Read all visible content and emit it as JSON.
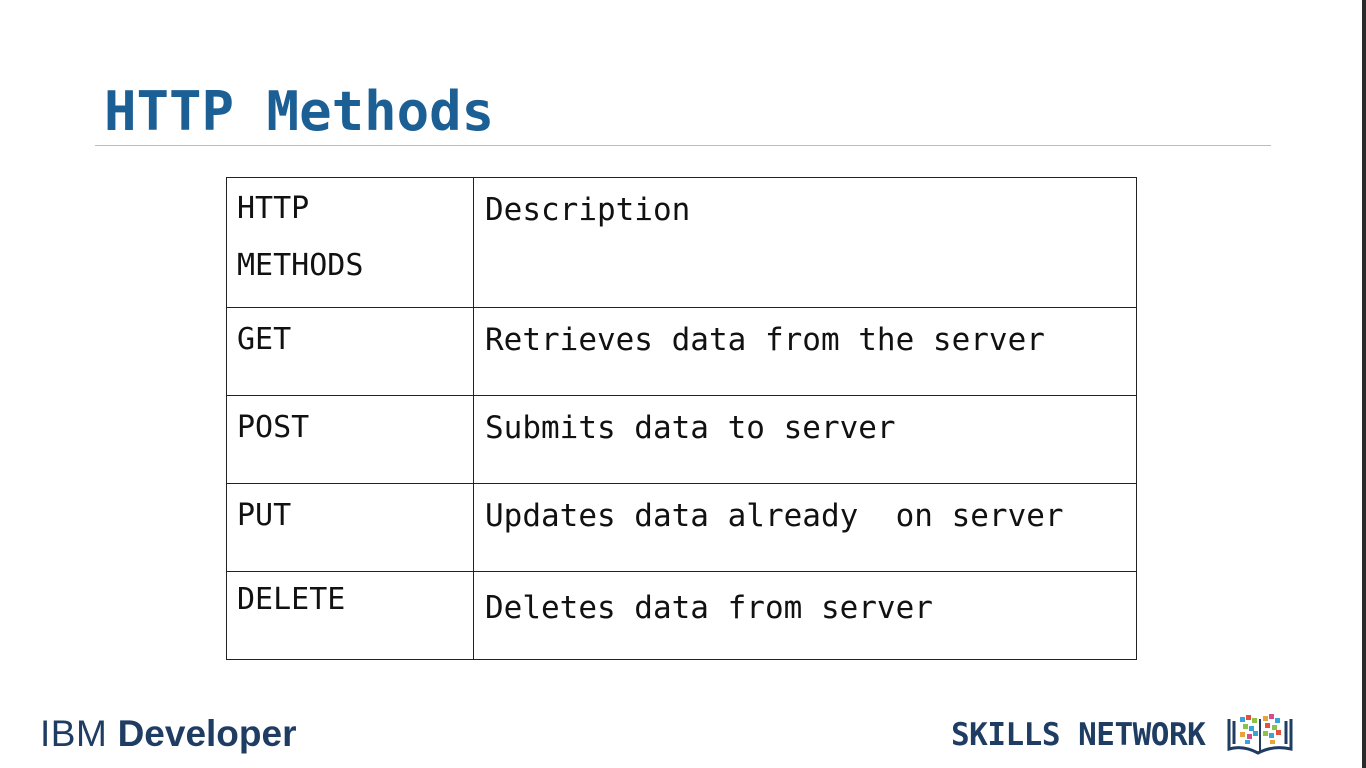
{
  "slide": {
    "title": "HTTP Methods"
  },
  "table": {
    "header": {
      "method_line1": "HTTP",
      "method_line2": "METHODS",
      "description": "Description"
    },
    "rows": [
      {
        "method": "GET",
        "description": "Retrieves data from the server"
      },
      {
        "method": "POST",
        "description": "Submits data to server"
      },
      {
        "method": "PUT",
        "description": "Updates data already  on server"
      },
      {
        "method": "DELETE",
        "description": "Deletes data from server"
      }
    ]
  },
  "footer": {
    "ibm_light": "IBM",
    "ibm_bold": "Developer",
    "skills_network": "SKILLS NETWORK",
    "skills_icon": "book-pixels-icon"
  },
  "colors": {
    "title": "#1b5f94",
    "brand_navy": "#1f3d63",
    "rule": "#a9c1d6"
  }
}
